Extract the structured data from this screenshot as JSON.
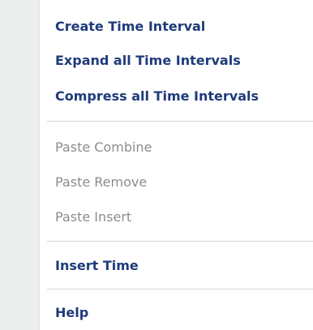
{
  "menu": {
    "items": [
      {
        "label": "Create Time Interval",
        "enabled": true
      },
      {
        "label": "Expand all Time Intervals",
        "enabled": true
      },
      {
        "label": "Compress all Time Intervals",
        "enabled": true
      },
      {
        "label": "Paste Combine",
        "enabled": false
      },
      {
        "label": "Paste Remove",
        "enabled": false
      },
      {
        "label": "Paste Insert",
        "enabled": false
      },
      {
        "label": "Insert Time",
        "enabled": true
      },
      {
        "label": "Help",
        "enabled": true
      }
    ]
  },
  "colors": {
    "enabled_text": "#1f3b7a",
    "disabled_text": "#8c8c8c",
    "gutter": "#eceded",
    "separator": "#d6d6d6"
  }
}
